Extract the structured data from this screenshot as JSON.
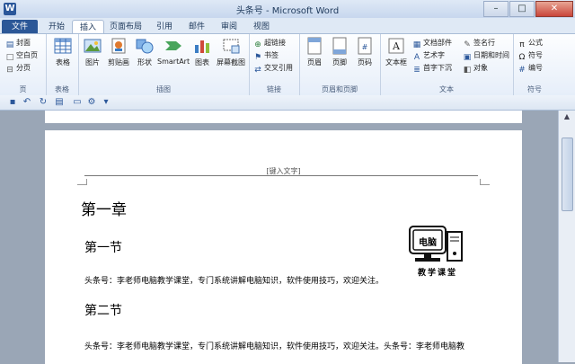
{
  "window": {
    "title": "头条号 - Microsoft Word",
    "app_icon": "W"
  },
  "tabs": [
    "文件",
    "开始",
    "插入",
    "页面布局",
    "引用",
    "邮件",
    "审阅",
    "视图"
  ],
  "ribbon": {
    "pages": {
      "label": "页",
      "items": [
        "封面",
        "空白页",
        "分页"
      ]
    },
    "tables": {
      "label": "表格",
      "items": [
        "表格"
      ]
    },
    "illustrations": {
      "label": "插图",
      "items": [
        "图片",
        "剪贴画",
        "形状",
        "SmartArt",
        "图表",
        "屏幕截图"
      ]
    },
    "links": {
      "label": "链接",
      "items": [
        "超链接",
        "书签",
        "交叉引用"
      ]
    },
    "header_footer": {
      "label": "页眉和页脚",
      "items": [
        "页眉",
        "页脚",
        "页码"
      ]
    },
    "text": {
      "label": "文本",
      "items": [
        "文本框",
        "文档部件",
        "艺术字",
        "首字下沉",
        "签名行",
        "日期和时间",
        "对象"
      ]
    },
    "symbols": {
      "label": "符号",
      "items": [
        "公式",
        "符号",
        "编号"
      ]
    }
  },
  "document": {
    "header_placeholder": "[键入文字]",
    "chapter": "第一章",
    "section1": "第一节",
    "para1": "头条号：李老师电脑教学课堂，专门系统讲解电脑知识，软件使用技巧，欢迎关注。",
    "section2": "第二节",
    "para2": "头条号：李老师电脑教学课堂，专门系统讲解电脑知识，软件使用技巧，欢迎关注。头条号：李老师电脑教",
    "logo_screen_text": "电脑",
    "logo_caption": "教学课堂"
  },
  "colors": {
    "file_tab": "#2b5797",
    "accent": "#2b579a"
  }
}
